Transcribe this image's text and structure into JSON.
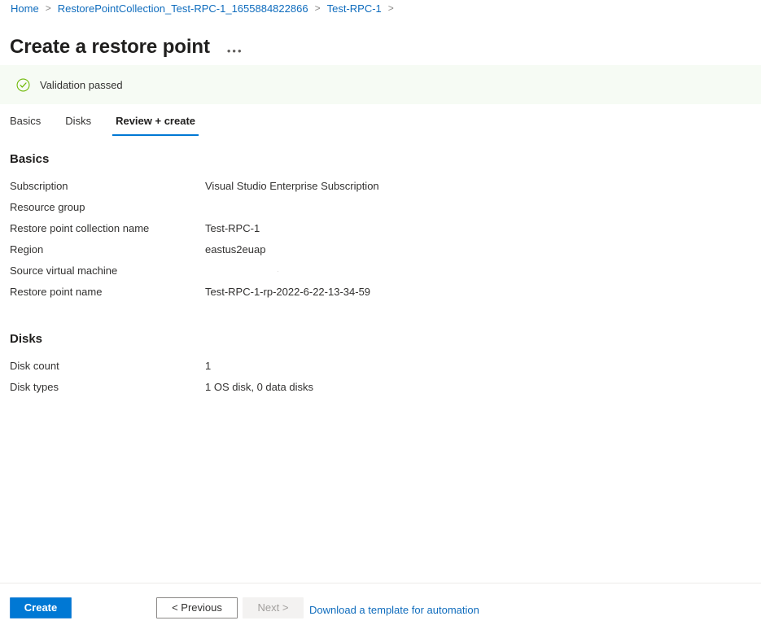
{
  "breadcrumb": {
    "items": [
      {
        "label": "Home"
      },
      {
        "label": "RestorePointCollection_Test-RPC-1_1655884822866"
      },
      {
        "label": "Test-RPC-1"
      }
    ],
    "separator": ">"
  },
  "header": {
    "title": "Create a restore point",
    "more_menu_label": "•••"
  },
  "validation": {
    "message": "Validation passed",
    "icon": "check-circle-icon",
    "background_color": "#F6FBF4",
    "icon_color": "#6BB700"
  },
  "tabs": [
    {
      "label": "Basics",
      "active": false
    },
    {
      "label": "Disks",
      "active": false
    },
    {
      "label": "Review + create",
      "active": true
    }
  ],
  "sections": [
    {
      "heading": "Basics",
      "rows": [
        {
          "label": "Subscription",
          "value": "Visual Studio Enterprise Subscription"
        },
        {
          "label": "Resource group",
          "value": ""
        },
        {
          "label": "Restore point collection name",
          "value": "Test-RPC-1"
        },
        {
          "label": "Region",
          "value": "eastus2euap"
        },
        {
          "label": "Source virtual machine",
          "value": "·"
        },
        {
          "label": "Restore point name",
          "value": "Test-RPC-1-rp-2022-6-22-13-34-59"
        }
      ]
    },
    {
      "heading": "Disks",
      "rows": [
        {
          "label": "Disk count",
          "value": "1"
        },
        {
          "label": "Disk types",
          "value": "1 OS disk, 0 data disks"
        }
      ]
    }
  ],
  "footer": {
    "create_label": "Create",
    "previous_label": "< Previous",
    "next_label": "Next >",
    "next_disabled": true,
    "template_link_label": "Download a template for automation"
  },
  "colors": {
    "accent": "#0078D4",
    "link": "#0F6CBD",
    "text": "#323130",
    "success": "#6BB700"
  }
}
